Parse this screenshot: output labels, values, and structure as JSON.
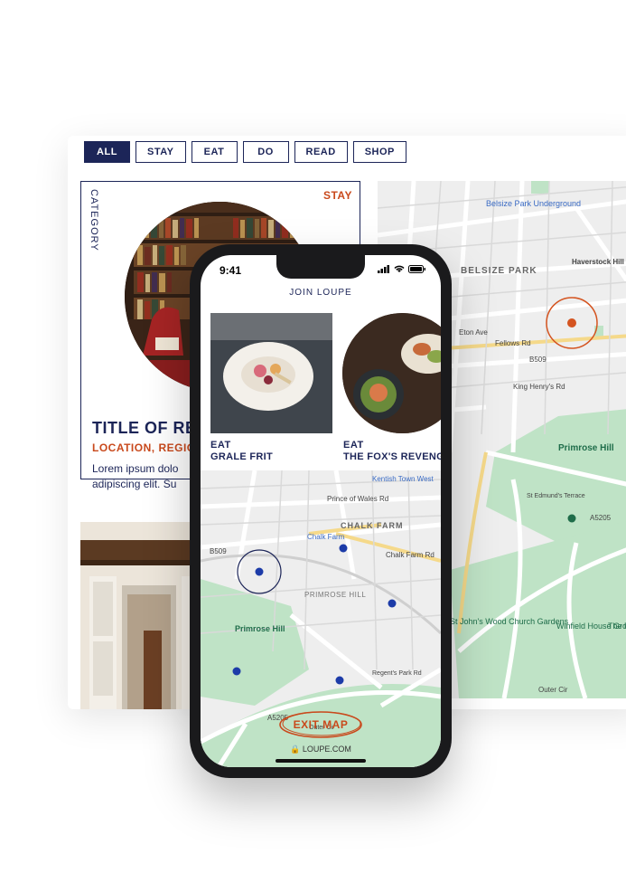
{
  "tabs": [
    "ALL",
    "STAY",
    "EAT",
    "DO",
    "READ",
    "SHOP"
  ],
  "card": {
    "vertical_label": "CATEGORY",
    "tag": "STAY",
    "title": "TITLE OF RE",
    "subtitle": "LOCATION, REGIO",
    "body_line1": "Lorem ipsum dolo",
    "body_line2": "adipiscing elit.  Su"
  },
  "desk_map": {
    "labels": {
      "station": "Belsize Park Underground",
      "belsize": "BELSIZE PARK",
      "haverstock": "Haverstock Hill",
      "primrose": "Primrose Hill",
      "b509": "B509",
      "a5205": "A5205",
      "winfield": "Winfield House Grounds",
      "stjohns": "St John's Wood Church Gardens",
      "outer": "Outer Cir",
      "eton": "Eton Ave",
      "fellows": "Fellows Rd",
      "kinghenry": "King Henry's Rd",
      "stedmunds": "St Edmund's Terrace",
      "thepr": "The Pr"
    }
  },
  "phone": {
    "time": "9:41",
    "brand": "JOIN LOUPE",
    "items": [
      {
        "category": "EAT",
        "name": "GRALE FRIT"
      },
      {
        "category": "EAT",
        "name": "THE FOX'S REVENG"
      }
    ],
    "map_labels": {
      "kentish": "Kentish Town West",
      "princeofwales": "Prince of Wales Rd",
      "chalkfarm": "CHALK FARM",
      "chalkstation": "Chalk Farm",
      "chalkrd": "Chalk Farm Rd",
      "primrosehill": "PRIMROSE HILL",
      "primrosepark": "Primrose Hill",
      "b509": "B509",
      "a5205": "A5205",
      "regents": "Regent's Park Rd",
      "outercir": "Outer Cir"
    },
    "exit_label": "EXIT MAP",
    "url": "LOUPE.COM"
  },
  "colors": {
    "navy": "#1c2558",
    "accent": "#c9491c",
    "park": "#bfe3c6",
    "road": "#ffffff",
    "map_bg": "#eeeeee"
  }
}
